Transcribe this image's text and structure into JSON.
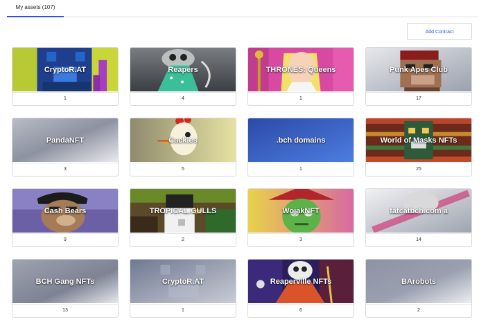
{
  "tabs": [
    {
      "label": "My assets (107)"
    }
  ],
  "toolbar": {
    "add_contract_label": "Add Contract"
  },
  "collections": [
    {
      "name": "CryptoR.AT",
      "count": "1"
    },
    {
      "name": "Reapers",
      "count": "4"
    },
    {
      "name": "THRONES: Queens",
      "count": "1"
    },
    {
      "name": "Punk Apes Club",
      "count": "17"
    },
    {
      "name": "PandaNFT",
      "count": "3"
    },
    {
      "name": "Cackles",
      "count": "5"
    },
    {
      "name": ".bch domains",
      "count": "1"
    },
    {
      "name": "World of Masks NFTs",
      "count": "25"
    },
    {
      "name": "Cash Bears",
      "count": "9"
    },
    {
      "name": "TROPICAL.GULLS",
      "count": "2"
    },
    {
      "name": "WojakNFT",
      "count": "3"
    },
    {
      "name": "fatcatbch.com a",
      "count": "14"
    },
    {
      "name": "BCH Gang NFTs",
      "count": "13"
    },
    {
      "name": "CryptoR.AT",
      "count": "1"
    },
    {
      "name": "Reaperville NFTs",
      "count": "6"
    },
    {
      "name": "BArobots",
      "count": "2"
    }
  ],
  "colors": {
    "accent": "#2f53d8",
    "border": "#d6d9df"
  }
}
